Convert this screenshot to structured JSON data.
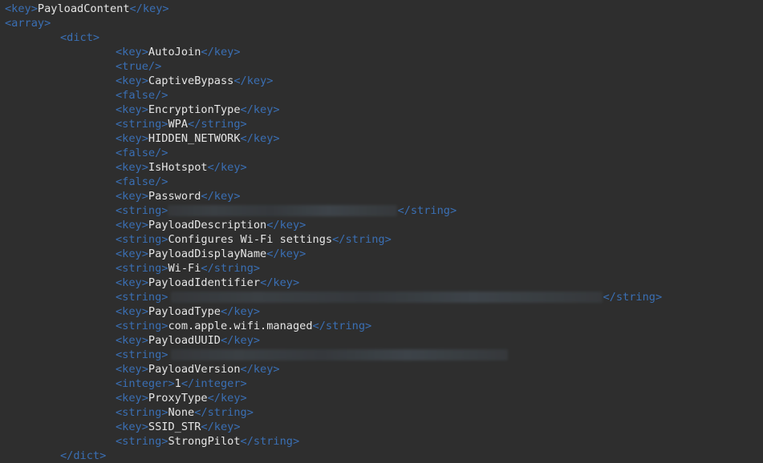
{
  "lines": {
    "l01": {
      "open": "<key>",
      "text": "PayloadContent",
      "close": "</key>"
    },
    "l02": {
      "tag": "<array>"
    },
    "l03": {
      "tag": "<dict>"
    },
    "l04": {
      "open": "<key>",
      "text": "AutoJoin",
      "close": "</key>"
    },
    "l05": {
      "tag": "<true/>"
    },
    "l06": {
      "open": "<key>",
      "text": "CaptiveBypass",
      "close": "</key>"
    },
    "l07": {
      "tag": "<false/>"
    },
    "l08": {
      "open": "<key>",
      "text": "EncryptionType",
      "close": "</key>"
    },
    "l09": {
      "open": "<string>",
      "text": "WPA",
      "close": "</string>"
    },
    "l10": {
      "open": "<key>",
      "text": "HIDDEN_NETWORK",
      "close": "</key>"
    },
    "l11": {
      "tag": "<false/>"
    },
    "l12": {
      "open": "<key>",
      "text": "IsHotspot",
      "close": "</key>"
    },
    "l13": {
      "tag": "<false/>"
    },
    "l14": {
      "open": "<key>",
      "text": "Password",
      "close": "</key>"
    },
    "l15": {
      "open": "<string>",
      "close": "</string>"
    },
    "l16": {
      "open": "<key>",
      "text": "PayloadDescription",
      "close": "</key>"
    },
    "l17": {
      "open": "<string>",
      "text": "Configures Wi-Fi settings",
      "close": "</string>"
    },
    "l18": {
      "open": "<key>",
      "text": "PayloadDisplayName",
      "close": "</key>"
    },
    "l19": {
      "open": "<string>",
      "text": "Wi-Fi",
      "close": "</string>"
    },
    "l20": {
      "open": "<key>",
      "text": "PayloadIdentifier",
      "close": "</key>"
    },
    "l21": {
      "open": "<string>",
      "close": "</string>"
    },
    "l22": {
      "open": "<key>",
      "text": "PayloadType",
      "close": "</key>"
    },
    "l23": {
      "open": "<string>",
      "text": "com.apple.wifi.managed",
      "close": "</string>"
    },
    "l24": {
      "open": "<key>",
      "text": "PayloadUUID",
      "close": "</key>"
    },
    "l25": {
      "open": "<string>"
    },
    "l26": {
      "open": "<key>",
      "text": "PayloadVersion",
      "close": "</key>"
    },
    "l27": {
      "open": "<integer>",
      "text": "1",
      "close": "</integer>"
    },
    "l28": {
      "open": "<key>",
      "text": "ProxyType",
      "close": "</key>"
    },
    "l29": {
      "open": "<string>",
      "text": "None",
      "close": "</string>"
    },
    "l30": {
      "open": "<key>",
      "text": "SSID_STR",
      "close": "</key>"
    },
    "l31": {
      "open": "<string>",
      "text": "StrongPilot",
      "close": "</string>"
    },
    "l32": {
      "tag": "</dict>"
    }
  },
  "colors": {
    "background": "#2e2e2e",
    "tag": "#3a6fb4",
    "text": "#e6e6e6"
  }
}
